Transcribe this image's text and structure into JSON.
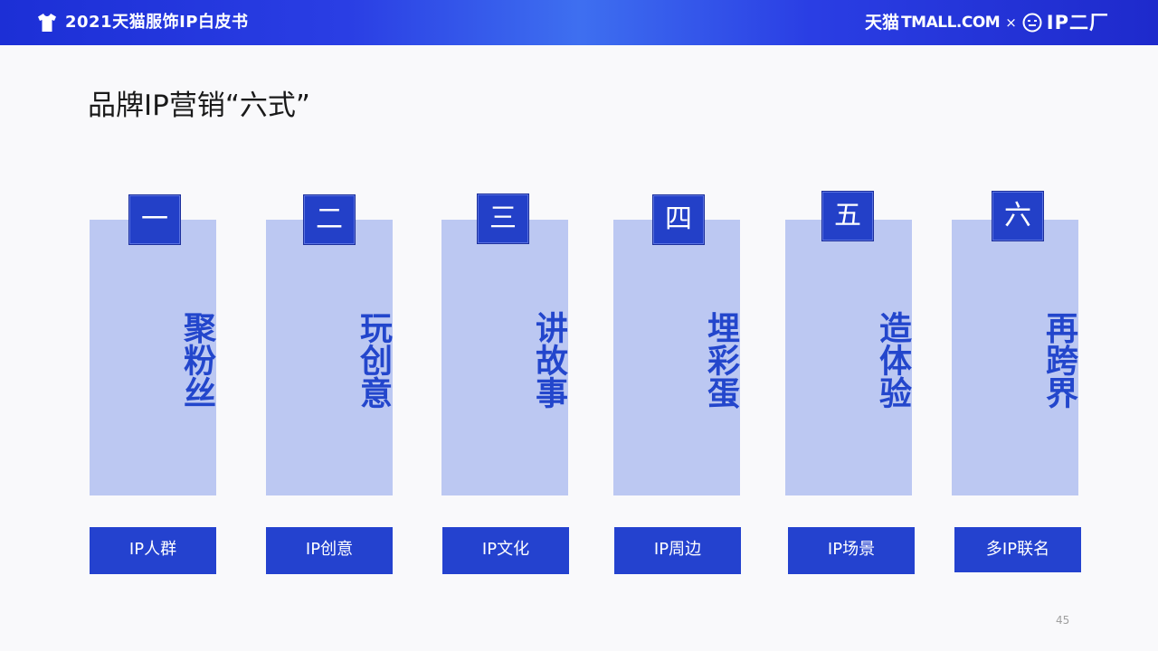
{
  "header": {
    "title": "2021天猫服饰IP白皮书",
    "brand_cn": "天猫",
    "brand_en": "TMALL.COM",
    "separator": "×",
    "partner": "IP二厂",
    "icons": [
      "tshirt-icon",
      "face-logo-icon"
    ],
    "gradient_colors": [
      "#1c2fd6",
      "#3e6ff0"
    ]
  },
  "page_title": "品牌IP营销“六式”",
  "columns": [
    {
      "number": "一",
      "action": "聚粉丝",
      "tag": "IP人群"
    },
    {
      "number": "二",
      "action": "玩创意",
      "tag": "IP创意"
    },
    {
      "number": "三",
      "action": "讲故事",
      "tag": "IP文化"
    },
    {
      "number": "四",
      "action": "埋彩蛋",
      "tag": "IP周边"
    },
    {
      "number": "五",
      "action": "造体验",
      "tag": "IP场景"
    },
    {
      "number": "六",
      "action": "再跨界",
      "tag": "多IP联名"
    }
  ],
  "colors": {
    "accent": "#2340c8",
    "card_bg": "#bcc8f2",
    "card_text": "#2346cc"
  },
  "page_number": "45"
}
